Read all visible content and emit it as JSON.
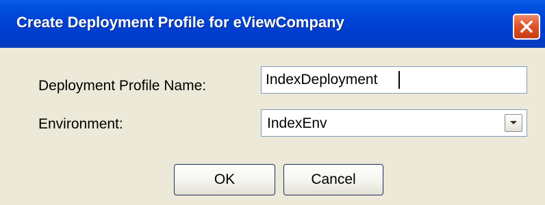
{
  "window": {
    "title": "Create Deployment Profile for eViewCompany",
    "close_icon": "close-icon"
  },
  "form": {
    "profile_name_label": "Deployment Profile Name:",
    "profile_name_value": "IndexDeployment",
    "environment_label": "Environment:",
    "environment_value": "IndexEnv",
    "dropdown_icon": "chevron-down-icon"
  },
  "buttons": {
    "ok_label": "OK",
    "cancel_label": "Cancel"
  },
  "colors": {
    "titlebar": "#0046d5",
    "title_text": "#ffffff",
    "close_button": "#e1542a",
    "dialog_background": "#ece9d8",
    "input_border": "#7f9db9"
  }
}
